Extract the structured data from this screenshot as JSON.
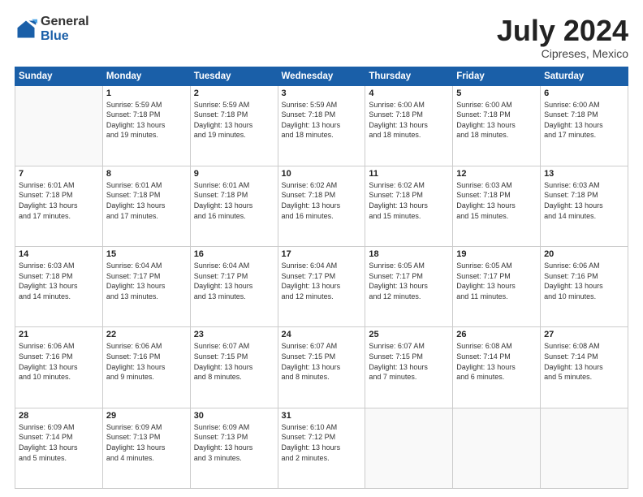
{
  "logo": {
    "general": "General",
    "blue": "Blue"
  },
  "title": {
    "month_year": "July 2024",
    "location": "Cipreses, Mexico"
  },
  "days_of_week": [
    "Sunday",
    "Monday",
    "Tuesday",
    "Wednesday",
    "Thursday",
    "Friday",
    "Saturday"
  ],
  "weeks": [
    [
      {
        "day": "",
        "info": ""
      },
      {
        "day": "1",
        "info": "Sunrise: 5:59 AM\nSunset: 7:18 PM\nDaylight: 13 hours\nand 19 minutes."
      },
      {
        "day": "2",
        "info": "Sunrise: 5:59 AM\nSunset: 7:18 PM\nDaylight: 13 hours\nand 19 minutes."
      },
      {
        "day": "3",
        "info": "Sunrise: 5:59 AM\nSunset: 7:18 PM\nDaylight: 13 hours\nand 18 minutes."
      },
      {
        "day": "4",
        "info": "Sunrise: 6:00 AM\nSunset: 7:18 PM\nDaylight: 13 hours\nand 18 minutes."
      },
      {
        "day": "5",
        "info": "Sunrise: 6:00 AM\nSunset: 7:18 PM\nDaylight: 13 hours\nand 18 minutes."
      },
      {
        "day": "6",
        "info": "Sunrise: 6:00 AM\nSunset: 7:18 PM\nDaylight: 13 hours\nand 17 minutes."
      }
    ],
    [
      {
        "day": "7",
        "info": "Sunrise: 6:01 AM\nSunset: 7:18 PM\nDaylight: 13 hours\nand 17 minutes."
      },
      {
        "day": "8",
        "info": "Sunrise: 6:01 AM\nSunset: 7:18 PM\nDaylight: 13 hours\nand 17 minutes."
      },
      {
        "day": "9",
        "info": "Sunrise: 6:01 AM\nSunset: 7:18 PM\nDaylight: 13 hours\nand 16 minutes."
      },
      {
        "day": "10",
        "info": "Sunrise: 6:02 AM\nSunset: 7:18 PM\nDaylight: 13 hours\nand 16 minutes."
      },
      {
        "day": "11",
        "info": "Sunrise: 6:02 AM\nSunset: 7:18 PM\nDaylight: 13 hours\nand 15 minutes."
      },
      {
        "day": "12",
        "info": "Sunrise: 6:03 AM\nSunset: 7:18 PM\nDaylight: 13 hours\nand 15 minutes."
      },
      {
        "day": "13",
        "info": "Sunrise: 6:03 AM\nSunset: 7:18 PM\nDaylight: 13 hours\nand 14 minutes."
      }
    ],
    [
      {
        "day": "14",
        "info": "Sunrise: 6:03 AM\nSunset: 7:18 PM\nDaylight: 13 hours\nand 14 minutes."
      },
      {
        "day": "15",
        "info": "Sunrise: 6:04 AM\nSunset: 7:17 PM\nDaylight: 13 hours\nand 13 minutes."
      },
      {
        "day": "16",
        "info": "Sunrise: 6:04 AM\nSunset: 7:17 PM\nDaylight: 13 hours\nand 13 minutes."
      },
      {
        "day": "17",
        "info": "Sunrise: 6:04 AM\nSunset: 7:17 PM\nDaylight: 13 hours\nand 12 minutes."
      },
      {
        "day": "18",
        "info": "Sunrise: 6:05 AM\nSunset: 7:17 PM\nDaylight: 13 hours\nand 12 minutes."
      },
      {
        "day": "19",
        "info": "Sunrise: 6:05 AM\nSunset: 7:17 PM\nDaylight: 13 hours\nand 11 minutes."
      },
      {
        "day": "20",
        "info": "Sunrise: 6:06 AM\nSunset: 7:16 PM\nDaylight: 13 hours\nand 10 minutes."
      }
    ],
    [
      {
        "day": "21",
        "info": "Sunrise: 6:06 AM\nSunset: 7:16 PM\nDaylight: 13 hours\nand 10 minutes."
      },
      {
        "day": "22",
        "info": "Sunrise: 6:06 AM\nSunset: 7:16 PM\nDaylight: 13 hours\nand 9 minutes."
      },
      {
        "day": "23",
        "info": "Sunrise: 6:07 AM\nSunset: 7:15 PM\nDaylight: 13 hours\nand 8 minutes."
      },
      {
        "day": "24",
        "info": "Sunrise: 6:07 AM\nSunset: 7:15 PM\nDaylight: 13 hours\nand 8 minutes."
      },
      {
        "day": "25",
        "info": "Sunrise: 6:07 AM\nSunset: 7:15 PM\nDaylight: 13 hours\nand 7 minutes."
      },
      {
        "day": "26",
        "info": "Sunrise: 6:08 AM\nSunset: 7:14 PM\nDaylight: 13 hours\nand 6 minutes."
      },
      {
        "day": "27",
        "info": "Sunrise: 6:08 AM\nSunset: 7:14 PM\nDaylight: 13 hours\nand 5 minutes."
      }
    ],
    [
      {
        "day": "28",
        "info": "Sunrise: 6:09 AM\nSunset: 7:14 PM\nDaylight: 13 hours\nand 5 minutes."
      },
      {
        "day": "29",
        "info": "Sunrise: 6:09 AM\nSunset: 7:13 PM\nDaylight: 13 hours\nand 4 minutes."
      },
      {
        "day": "30",
        "info": "Sunrise: 6:09 AM\nSunset: 7:13 PM\nDaylight: 13 hours\nand 3 minutes."
      },
      {
        "day": "31",
        "info": "Sunrise: 6:10 AM\nSunset: 7:12 PM\nDaylight: 13 hours\nand 2 minutes."
      },
      {
        "day": "",
        "info": ""
      },
      {
        "day": "",
        "info": ""
      },
      {
        "day": "",
        "info": ""
      }
    ]
  ]
}
